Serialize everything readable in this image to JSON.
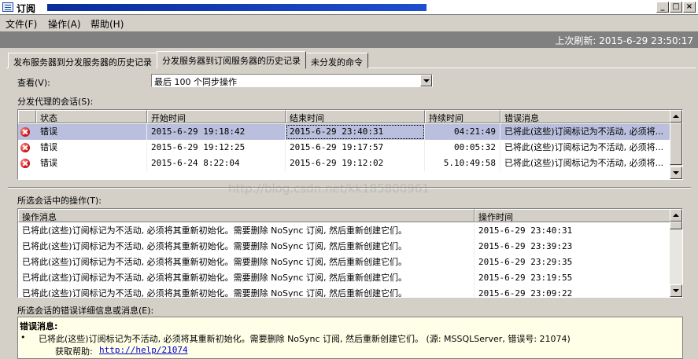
{
  "window": {
    "title": "订阅"
  },
  "menu": [
    "文件(F)",
    "操作(A)",
    "帮助(H)"
  ],
  "status": {
    "last_refresh": "上次刷新: 2015-6-29 23:50:17"
  },
  "tabs": [
    {
      "label": "发布服务器到分发服务器的历史记录",
      "active": false
    },
    {
      "label": "分发服务器到订阅服务器的历史记录",
      "active": true
    },
    {
      "label": "未分发的命令",
      "active": false
    }
  ],
  "view": {
    "label": "查看(V):",
    "selected": "最后 100 个同步操作"
  },
  "sessions": {
    "label": "分发代理的会话(S):",
    "columns": [
      "状态",
      "开始时间",
      "结束时间",
      "持续时间",
      "错误消息"
    ],
    "rows": [
      {
        "status": "错误",
        "start": "2015-6-29 19:18:42",
        "end": "2015-6-29 23:40:31",
        "duration": "04:21:49",
        "message": "已将此(这些)订阅标记为不活动, 必须将...",
        "selected": true
      },
      {
        "status": "错误",
        "start": "2015-6-29 19:12:25",
        "end": "2015-6-29 19:17:57",
        "duration": "00:05:32",
        "message": "已将此(这些)订阅标记为不活动, 必须将...",
        "selected": false
      },
      {
        "status": "错误",
        "start": "2015-6-24 8:22:04",
        "end": "2015-6-29 19:12:02",
        "duration": "5.10:49:58",
        "message": "已将此(这些)订阅标记为不活动, 必须将...",
        "selected": false
      }
    ]
  },
  "actions": {
    "label": "所选会话中的操作(T):",
    "columns": [
      "操作消息",
      "操作时间"
    ],
    "rows": [
      {
        "message": "已将此(这些)订阅标记为不活动, 必须将其重新初始化。需要删除 NoSync 订阅, 然后重新创建它们。",
        "time": "2015-6-29 23:40:31"
      },
      {
        "message": "已将此(这些)订阅标记为不活动, 必须将其重新初始化。需要删除 NoSync 订阅, 然后重新创建它们。",
        "time": "2015-6-29 23:39:23"
      },
      {
        "message": "已将此(这些)订阅标记为不活动, 必须将其重新初始化。需要删除 NoSync 订阅, 然后重新创建它们。",
        "time": "2015-6-29 23:29:35"
      },
      {
        "message": "已将此(这些)订阅标记为不活动, 必须将其重新初始化。需要删除 NoSync 订阅, 然后重新创建它们。",
        "time": "2015-6-29 23:19:55"
      },
      {
        "message": "已将此(这些)订阅标记为不活动, 必须将其重新初始化。需要删除 NoSync 订阅, 然后重新创建它们。",
        "time": "2015-6-29 23:09:22"
      }
    ]
  },
  "details": {
    "label": "所选会话的错误详细信息或消息(E):",
    "title": "错误消息:",
    "bullet": "•",
    "message": "已将此(这些)订阅标记为不活动, 必须将其重新初始化。需要删除 NoSync 订阅, 然后重新创建它们。 (源: MSSQLServer, 错误号: 21074)",
    "help_label": "获取帮助:",
    "help_link": "http://help/21074"
  },
  "watermark": "http://blog.csdn.net/kk185800961",
  "colors": {
    "selected_row": "#b9bfdc",
    "title_band": "#1f4fcf",
    "details_bg": "#ffffe8",
    "link": "#0000cc"
  }
}
